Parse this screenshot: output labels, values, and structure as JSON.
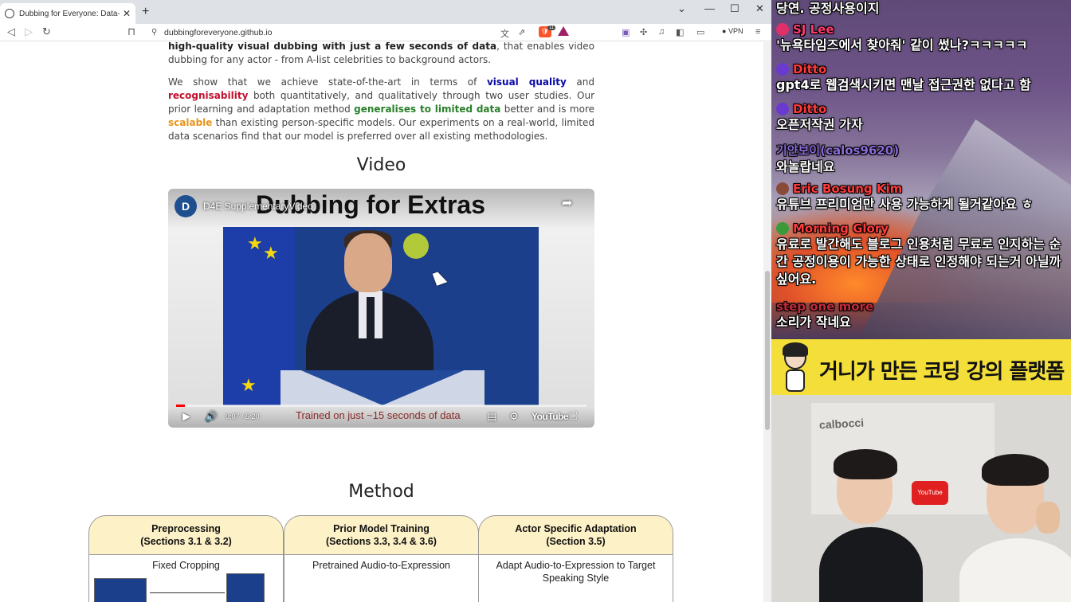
{
  "browser": {
    "tab_title": "Dubbing for Everyone: Data-Effic",
    "url": "dubbingforeveryone.github.io",
    "shields_count": "11",
    "vpn_label": "VPN"
  },
  "page": {
    "para1_bold": "high-quality visual dubbing with just a few seconds of data",
    "para1_rest": ", that enables video dubbing for any actor - from A-list celebrities to background actors.",
    "para2_a": "We show that we achieve state-of-the-art in terms of ",
    "para2_visual_quality": "visual quality",
    "para2_b": " and ",
    "para2_recognisability": "recognisability",
    "para2_c": " both quantitatively, and qualitatively through two user studies. Our prior learning and adaptation method ",
    "para2_generalises": "generalises to limited data",
    "para2_d": " better and is more ",
    "para2_scalable": "scalable",
    "para2_e": " than existing person-specific models. Our experiments on a real-world, limited data scenarios find that our model is preferred over all existing methodologies.",
    "video_heading": "Video",
    "method_heading": "Method"
  },
  "video": {
    "channel_avatar_letter": "D",
    "channel_title": "D4E SupplementaryVideo",
    "overlay_title": "Dubbing for Extras",
    "time": "0:07 / 5:20",
    "caption": "Trained on just ~15 seconds of data",
    "youtube_label": "YouTube",
    "progress_fraction": 0.022
  },
  "method": {
    "columns": [
      {
        "title_line1": "Preprocessing",
        "title_line2": "(Sections 3.1 & 3.2)",
        "body": "Fixed Cropping"
      },
      {
        "title_line1": "Prior Model Training",
        "title_line2": "(Sections 3.3, 3.4 & 3.6)",
        "body": "Pretrained Audio-to-Expression"
      },
      {
        "title_line1": "Actor Specific Adaptation",
        "title_line2": "(Section 3.5)",
        "body": "Adapt Audio-to-Expression to Target Speaking Style"
      }
    ]
  },
  "chat": {
    "messages": [
      {
        "name": "",
        "text": "당연. 공정사용이지",
        "name_color": "#ffffff",
        "badge_color": ""
      },
      {
        "name": "SJ Lee",
        "text": "'뉴욕타임즈에서 찾아줘' 같이 썼나?ㅋㅋㅋㅋㅋ",
        "name_color": "#ff3a6e",
        "badge_color": "#e0306a"
      },
      {
        "name": "Ditto",
        "text": "gpt4로 웹검색시키면 맨날 접근권한 없다고 함",
        "name_color": "#ff3a3a",
        "badge_color": "#6a3ad0"
      },
      {
        "name": "Ditto",
        "text": "오픈저작권 가자",
        "name_color": "#ff3a3a",
        "badge_color": "#6a3ad0"
      },
      {
        "name": "기얀보이(calos9620)",
        "text": "와놀랍네요",
        "name_color": "#8a6ad8",
        "badge_color": ""
      },
      {
        "name": "Eric Bosung Kim",
        "text": "유튜브 프리미엄만 사용 가능하게 될거같아요 ㅎ",
        "name_color": "#ff3a3a",
        "badge_color": "#8a4a3a"
      },
      {
        "name": "Morning Glory",
        "text": "유료로 발간해도 블로그 인용처럼 무료로 인지하는 순간 공정이용이 가능한 상태로 인정해야 되는거 아닐까 싶어요.",
        "name_color": "#ff3a3a",
        "badge_color": "#3a9a3a"
      },
      {
        "name": "step one more",
        "text": "소리가 작네요",
        "name_color": "#c02a3a",
        "badge_color": ""
      }
    ]
  },
  "banner": {
    "text": "거니가 만든 코딩 강의 플랫폼"
  },
  "webcam": {
    "sign_text": "calbocci",
    "yt_sign": "YouTube"
  }
}
